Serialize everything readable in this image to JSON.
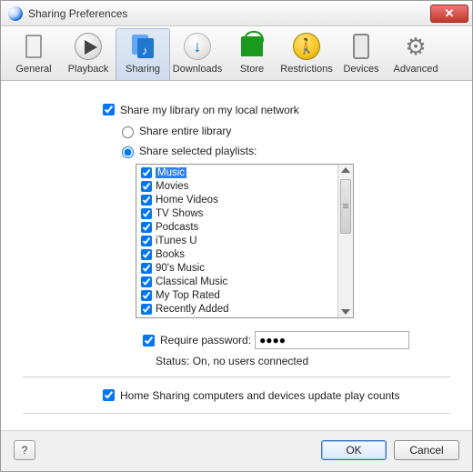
{
  "window": {
    "title": "Sharing Preferences"
  },
  "toolbar": [
    {
      "id": "general",
      "label": "General"
    },
    {
      "id": "playback",
      "label": "Playback"
    },
    {
      "id": "sharing",
      "label": "Sharing",
      "active": true
    },
    {
      "id": "downloads",
      "label": "Downloads"
    },
    {
      "id": "store",
      "label": "Store"
    },
    {
      "id": "restrictions",
      "label": "Restrictions"
    },
    {
      "id": "devices",
      "label": "Devices"
    },
    {
      "id": "advanced",
      "label": "Advanced"
    }
  ],
  "form": {
    "share_library": {
      "label": "Share my library on my local network",
      "checked": true
    },
    "share_entire": {
      "label": "Share entire library",
      "selected": false
    },
    "share_selected": {
      "label": "Share selected playlists:",
      "selected": true
    },
    "playlists": [
      {
        "label": "Music",
        "checked": true,
        "selected": true
      },
      {
        "label": "Movies",
        "checked": true
      },
      {
        "label": "Home Videos",
        "checked": true
      },
      {
        "label": "TV Shows",
        "checked": true
      },
      {
        "label": "Podcasts",
        "checked": true
      },
      {
        "label": "iTunes U",
        "checked": true
      },
      {
        "label": "Books",
        "checked": true
      },
      {
        "label": "90's Music",
        "checked": true
      },
      {
        "label": "Classical Music",
        "checked": true
      },
      {
        "label": "My Top Rated",
        "checked": true
      },
      {
        "label": "Recently Added",
        "checked": true
      }
    ],
    "require_password": {
      "label": "Require password:",
      "checked": true,
      "value": "●●●●"
    },
    "status": {
      "label": "Status:",
      "value": "On, no users connected"
    },
    "home_sharing": {
      "label": "Home Sharing computers and devices update play counts",
      "checked": true
    }
  },
  "footer": {
    "help": "?",
    "ok": "OK",
    "cancel": "Cancel"
  }
}
